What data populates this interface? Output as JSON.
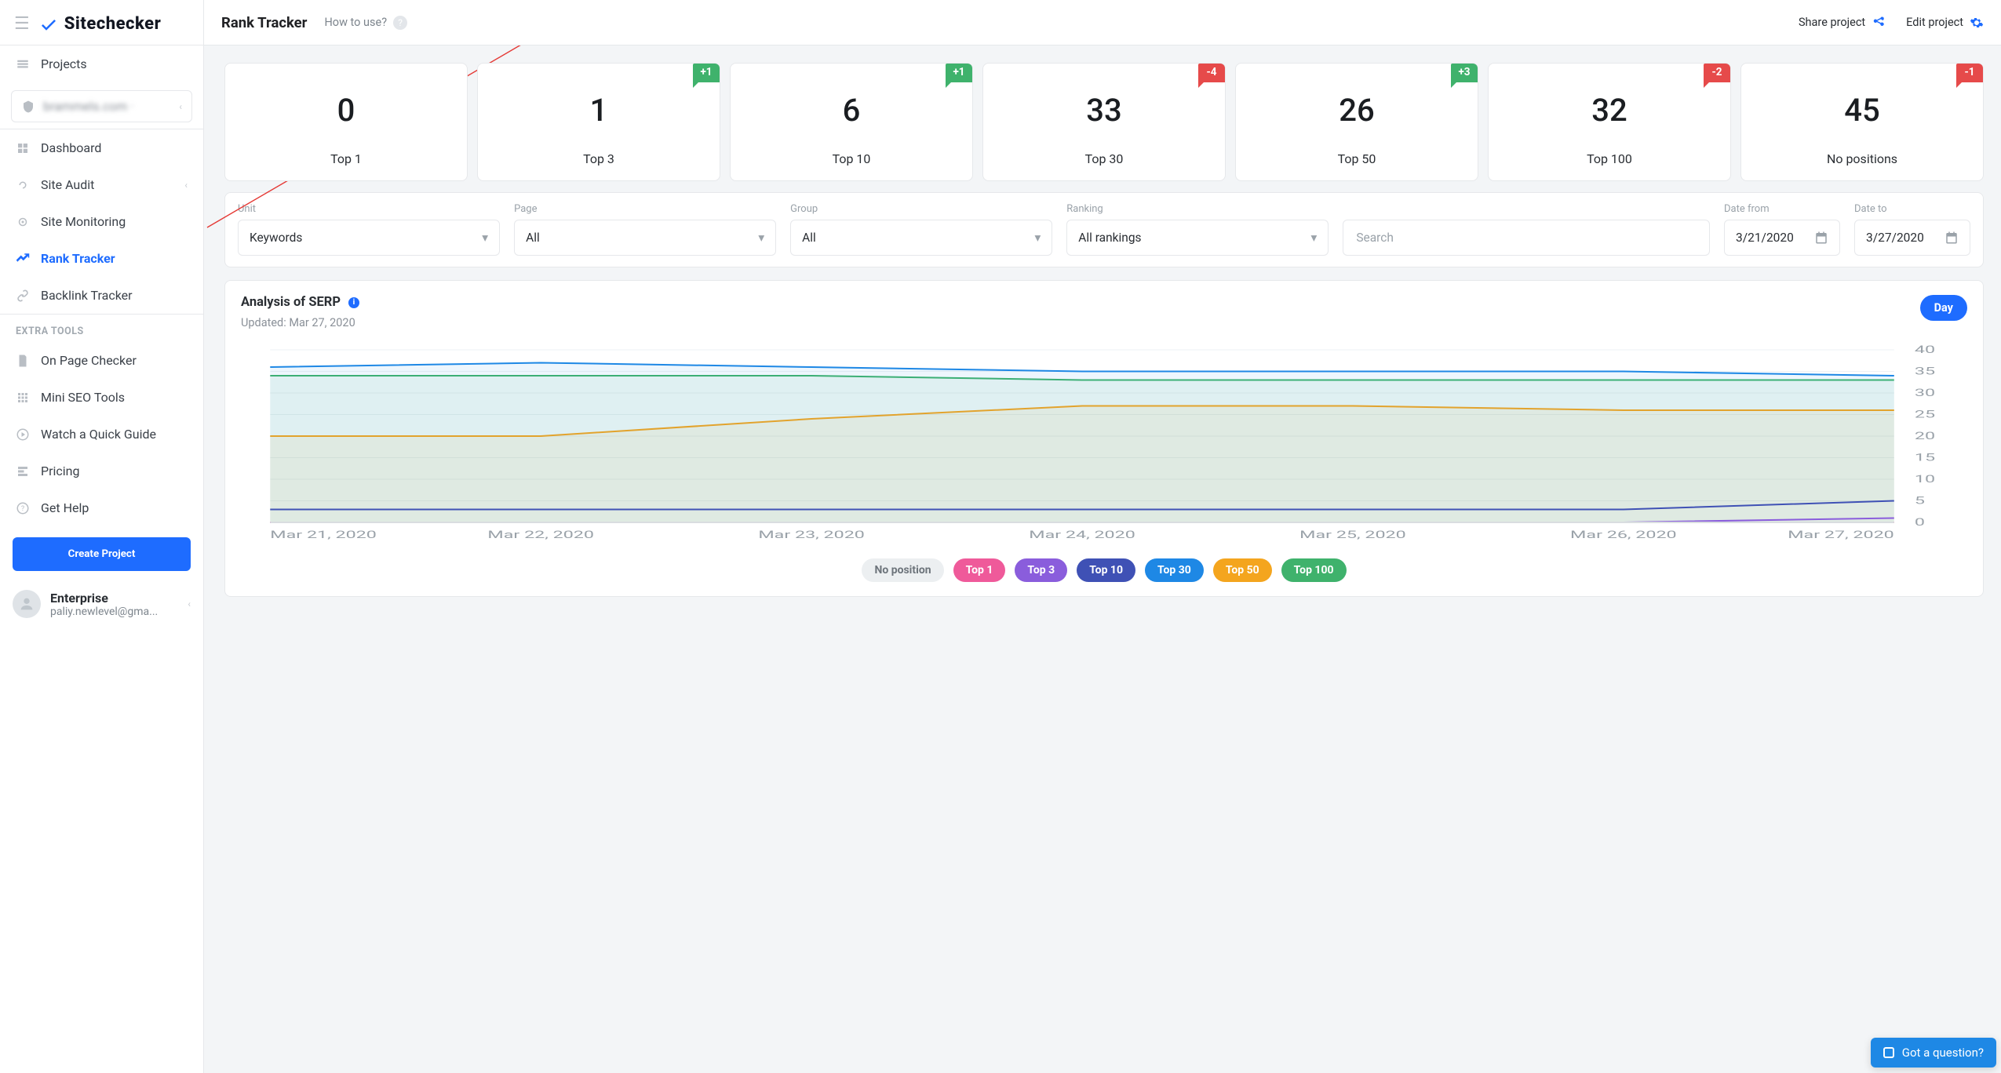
{
  "app": {
    "name": "Sitechecker"
  },
  "topbar": {
    "title": "Rank Tracker",
    "how_to_use": "How to use?",
    "share": "Share project",
    "edit": "Edit project"
  },
  "sidebar": {
    "projects": "Projects",
    "current_project": "brammels.com  ·  ",
    "nav": [
      {
        "icon": "dashboard",
        "label": "Dashboard"
      },
      {
        "icon": "audit",
        "label": "Site Audit",
        "caret": true
      },
      {
        "icon": "monitoring",
        "label": "Site Monitoring"
      },
      {
        "icon": "rank",
        "label": "Rank Tracker",
        "active": true
      },
      {
        "icon": "backlink",
        "label": "Backlink Tracker"
      }
    ],
    "extra_label": "EXTRA TOOLS",
    "extra": [
      {
        "icon": "page",
        "label": "On Page Checker"
      },
      {
        "icon": "grid",
        "label": "Mini SEO Tools"
      },
      {
        "icon": "play",
        "label": "Watch a Quick Guide"
      },
      {
        "icon": "price",
        "label": "Pricing"
      },
      {
        "icon": "help",
        "label": "Get Help"
      }
    ],
    "create_project": "Create Project",
    "user": {
      "plan": "Enterprise",
      "email": "paliy.newlevel@gma..."
    }
  },
  "kpis": [
    {
      "value": "0",
      "label": "Top 1"
    },
    {
      "value": "1",
      "label": "Top 3",
      "delta": "+1",
      "delta_color": "green"
    },
    {
      "value": "6",
      "label": "Top 10",
      "delta": "+1",
      "delta_color": "green"
    },
    {
      "value": "33",
      "label": "Top 30",
      "delta": "-4",
      "delta_color": "red"
    },
    {
      "value": "26",
      "label": "Top 50",
      "delta": "+3",
      "delta_color": "green"
    },
    {
      "value": "32",
      "label": "Top 100",
      "delta": "-2",
      "delta_color": "red"
    },
    {
      "value": "45",
      "label": "No positions",
      "delta": "-1",
      "delta_color": "red"
    }
  ],
  "filters": {
    "unit": {
      "label": "Unit",
      "value": "Keywords"
    },
    "page": {
      "label": "Page",
      "value": "All"
    },
    "group": {
      "label": "Group",
      "value": "All"
    },
    "ranking": {
      "label": "Ranking",
      "value": "All rankings"
    },
    "search": {
      "placeholder": "Search"
    },
    "date_from": {
      "label": "Date from",
      "value": "3/21/2020"
    },
    "date_to": {
      "label": "Date to",
      "value": "3/27/2020"
    }
  },
  "chart": {
    "title": "Analysis of SERP",
    "updated": "Updated: Mar 27, 2020",
    "range_pill": "Day",
    "legend": [
      {
        "label": "No position",
        "color": "#eceff1",
        "text": "#6d747b"
      },
      {
        "label": "Top 1",
        "color": "#ef5a9a"
      },
      {
        "label": "Top 3",
        "color": "#8a5ddc"
      },
      {
        "label": "Top 10",
        "color": "#3f51b5"
      },
      {
        "label": "Top 30",
        "color": "#1e88e5"
      },
      {
        "label": "Top 50",
        "color": "#f4a51e"
      },
      {
        "label": "Top 100",
        "color": "#3fb26c"
      }
    ]
  },
  "chat": {
    "label": "Got a question?"
  },
  "chart_data": {
    "type": "line",
    "title": "Analysis of SERP",
    "xlabel": "",
    "ylabel": "",
    "ylim": [
      0,
      40
    ],
    "yticks": [
      0,
      5,
      10,
      15,
      20,
      25,
      30,
      35,
      40
    ],
    "x": [
      "Mar 21, 2020",
      "Mar 22, 2020",
      "Mar 23, 2020",
      "Mar 24, 2020",
      "Mar 25, 2020",
      "Mar 26, 2020",
      "Mar 27, 2020"
    ],
    "series": [
      {
        "name": "Top 100",
        "color": "#3fb26c",
        "values": [
          34,
          34,
          34,
          33,
          33,
          33,
          33
        ]
      },
      {
        "name": "Top 50",
        "color": "#f4a51e",
        "values": [
          20,
          20,
          24,
          27,
          27,
          26,
          26
        ]
      },
      {
        "name": "Top 30",
        "color": "#1e88e5",
        "values": [
          36,
          37,
          36,
          35,
          35,
          35,
          34
        ]
      },
      {
        "name": "Top 10",
        "color": "#3f51b5",
        "values": [
          3,
          3,
          3,
          3,
          3,
          3,
          5
        ]
      },
      {
        "name": "Top 3",
        "color": "#8a5ddc",
        "values": [
          0,
          0,
          0,
          0,
          0,
          0,
          1
        ]
      },
      {
        "name": "Top 1",
        "color": "#ef5a9a",
        "values": [
          0,
          0,
          0,
          0,
          0,
          0,
          0
        ]
      },
      {
        "name": "No position",
        "color": "#d9dde0",
        "values": [
          0,
          0,
          0,
          0,
          0,
          0,
          0
        ]
      }
    ]
  }
}
